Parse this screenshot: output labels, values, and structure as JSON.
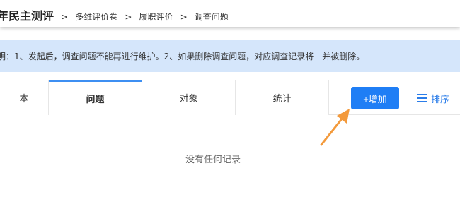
{
  "breadcrumb": {
    "title": "年民主测评",
    "separators": [
      ">",
      ">",
      ">"
    ],
    "items": [
      "多维评价卷",
      "履职评价",
      "调查问题"
    ]
  },
  "notice": {
    "text": "明：1、发起后，调查问题不能再进行维护。2、如果删除调查问题，对应调查记录将一并被删除。"
  },
  "tabs": [
    {
      "label": "本",
      "active": false
    },
    {
      "label": "问题",
      "active": true
    },
    {
      "label": "对象",
      "active": false
    },
    {
      "label": "统计",
      "active": false
    }
  ],
  "actions": {
    "add_label": "+增加",
    "sort_label": "排序",
    "sort_icon": "list-icon"
  },
  "empty_state": {
    "text": "没有任何记录"
  },
  "colors": {
    "accent": "#1f7ef5",
    "notice_bg": "#d5e6fb",
    "annotation_arrow": "#f39a3c"
  }
}
